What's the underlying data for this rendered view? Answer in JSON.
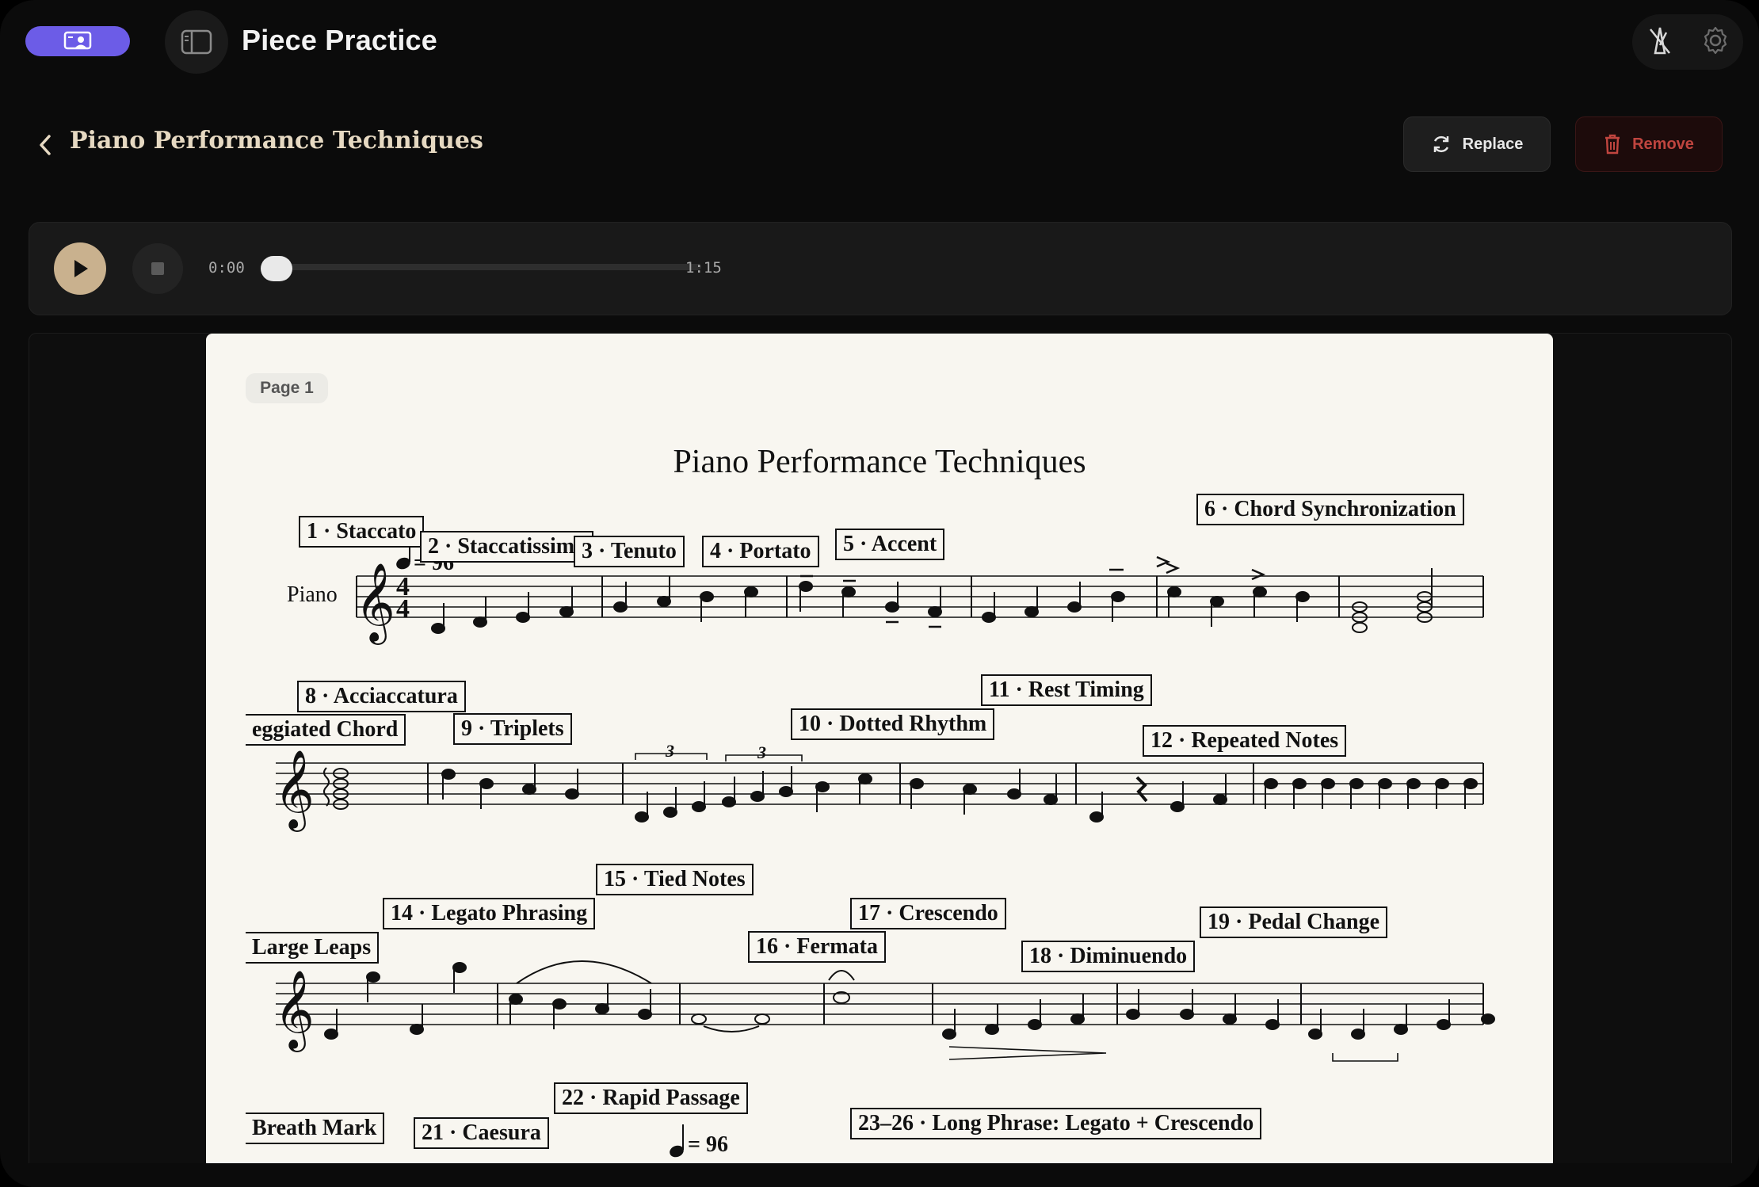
{
  "app": {
    "title": "Piece Practice",
    "colors": {
      "accent": "#6c5ce7",
      "play": "#c9b18e",
      "danger": "#c0453f",
      "title_text": "#e6d9c2"
    },
    "icons": {
      "mode": "presentation-icon",
      "sidebar": "sidebar-toggle-icon",
      "metronome": "metronome-off-icon",
      "settings": "gear-icon"
    }
  },
  "header": {
    "back_icon": "chevron-left-icon",
    "piece_title": "Piano Performance Techniques",
    "replace_label": "Replace",
    "replace_icon": "refresh-icon",
    "remove_label": "Remove",
    "remove_icon": "trash-icon"
  },
  "player": {
    "current_time": "0:00",
    "total_time": "1:15",
    "progress": 0,
    "play_icon": "play-icon",
    "stop_icon": "stop-icon"
  },
  "score": {
    "page_label": "Page 1",
    "title": "Piano Performance Techniques",
    "instrument": "Piano",
    "tempo": "= 96",
    "labels": [
      "1 · Staccato",
      "2 · Staccatissimo",
      "3 · Tenuto",
      "4 · Portato",
      "5 · Accent",
      "6 · Chord Synchronization",
      "8 · Acciaccatura",
      "eggiated Chord",
      "9 · Triplets",
      "10 · Dotted Rhythm",
      "11 · Rest Timing",
      "12 · Repeated Notes",
      "15 · Tied Notes",
      "14 · Legato Phrasing",
      "17 · Crescendo",
      "Large Leaps",
      "16 · Fermata",
      "19 · Pedal Change",
      "18 · Diminuendo",
      "22 · Rapid Passage",
      "Breath Mark",
      "21 · Caesura",
      "23–26 · Long Phrase: Legato + Crescendo"
    ],
    "triplet_mark": "3",
    "tempo2": "= 96"
  }
}
